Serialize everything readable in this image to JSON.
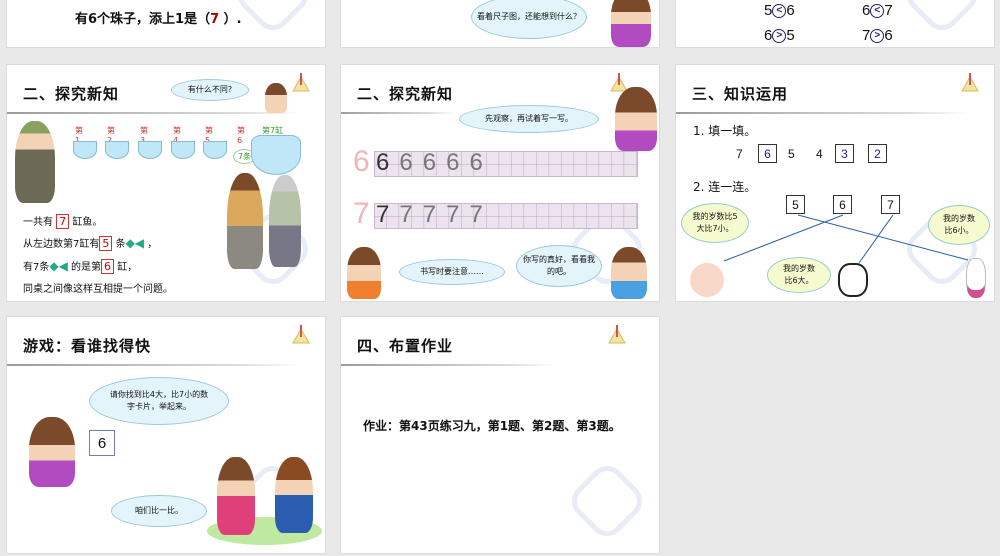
{
  "top_row": {
    "slide1_text_before": "有6个珠子，添上1是（",
    "slide1_answer": "7",
    "slide1_text_after": "  ）.",
    "slide2_bubble": "看着尺子图，还能想到什么？",
    "comparisons": [
      {
        "a": "5",
        "op": "<",
        "b": "6"
      },
      {
        "a": "6",
        "op": "<",
        "b": "7"
      },
      {
        "a": "6",
        "op": ">",
        "b": "5"
      },
      {
        "a": "7",
        "op": ">",
        "b": "6"
      }
    ]
  },
  "slide_explore1": {
    "title": "二、探究新知",
    "bubble": "有什么不同?",
    "bowl_labels": [
      "第1",
      "第2",
      "第3",
      "第4",
      "第5",
      "第6",
      "第7缸"
    ],
    "bowl_seven_label": "7条",
    "line1_before": "一共有",
    "line1_box": "7",
    "line1_after": "缸鱼。",
    "line2_before": "从左边数第7缸有",
    "line2_box": "5",
    "line2_after": "条",
    "line3_before": "有7条",
    "line3_mid": "的是第",
    "line3_box": "6",
    "line3_after": "缸，",
    "line4": "同桌之间像这样互相提一个问题。"
  },
  "slide_explore2": {
    "title": "二、探究新知",
    "bubble_top": "先观察，再试着写一写。",
    "digit_six": "6",
    "digit_seven": "7",
    "bubble_left": "书写时要注意……",
    "bubble_right": "你写的真好，看看我的吧。"
  },
  "slide_apply": {
    "title": "三、知识运用",
    "q1": "1. 填一填。",
    "sequence": [
      "7",
      "6",
      "5",
      "4",
      "3",
      "2"
    ],
    "q2": "2. 连一连。",
    "cards": [
      "5",
      "6",
      "7"
    ],
    "bubble_sheep": "我的岁数比5大比7小。",
    "bubble_cow": "我的岁数比6大。",
    "bubble_rabbit": "我的岁数比6小。"
  },
  "slide_game": {
    "title": "游戏：看谁找得快",
    "bubble_teacher": "请你找到比4大，比7小的数字卡片，举起来。",
    "card": "6",
    "bubble_kids": "咱们比一比。"
  },
  "slide_homework": {
    "title": "四、布置作业",
    "text": "作业：第43页练习九，第1题、第2题、第3题。"
  }
}
